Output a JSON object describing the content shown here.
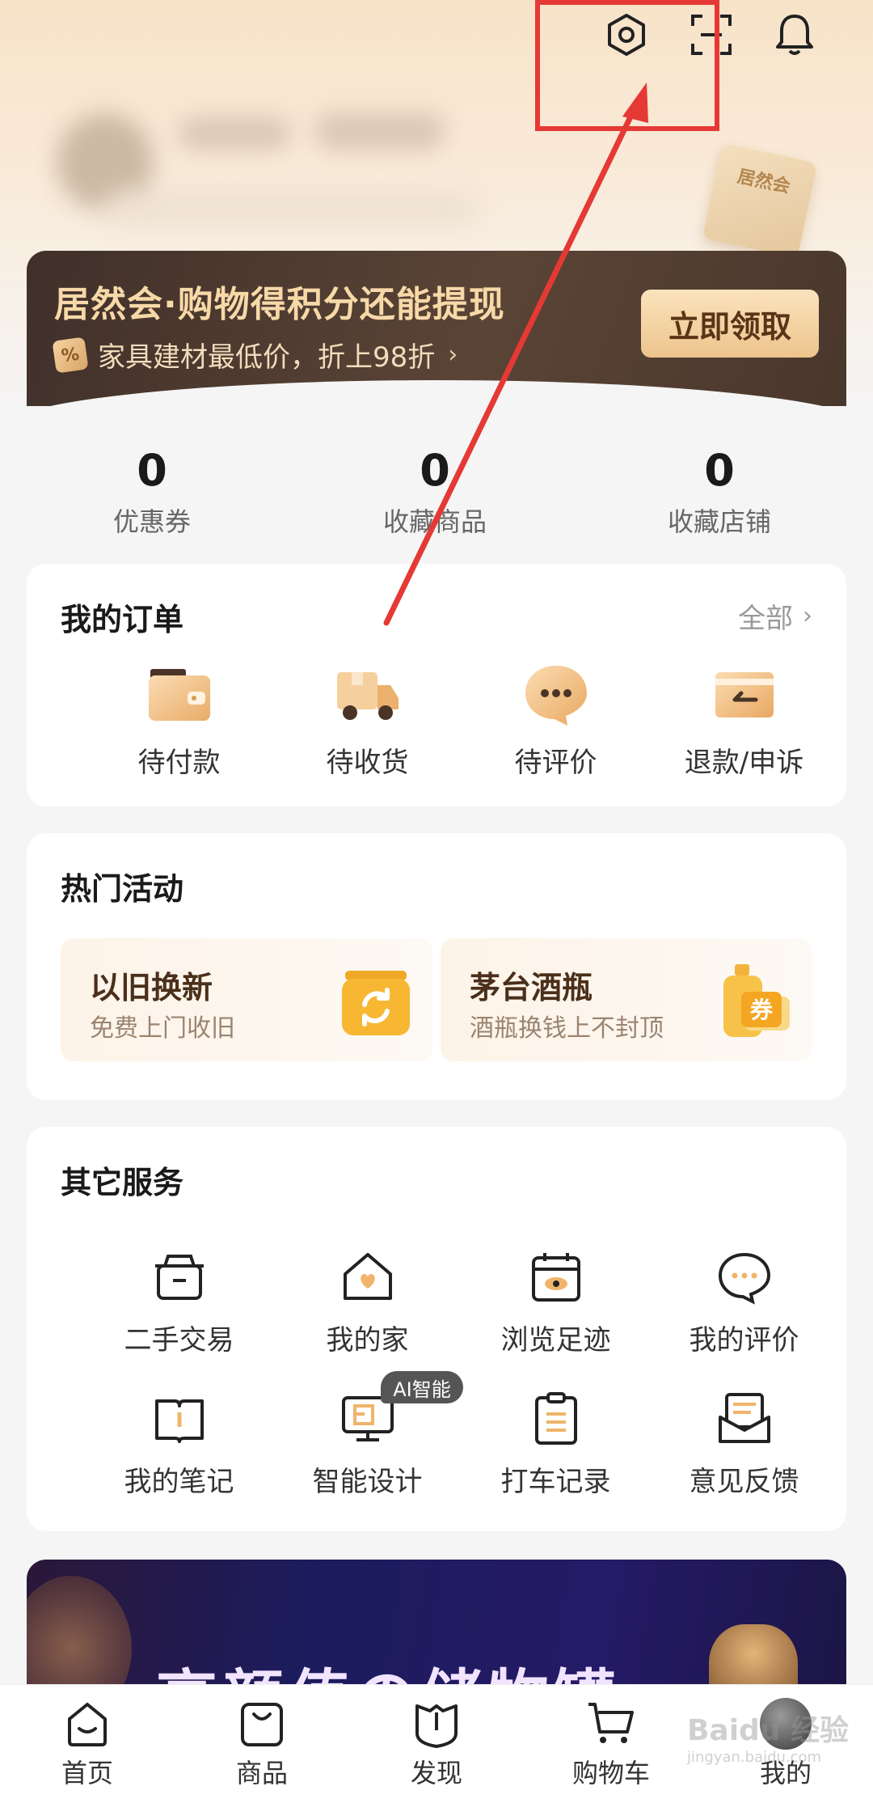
{
  "header": {
    "icons": [
      "settings-icon",
      "scan-icon",
      "bell-icon"
    ],
    "card_label": "居然会"
  },
  "banner": {
    "title": "居然会·购物得积分还能提现",
    "subtitle": "家具建材最低价，折上98折",
    "badge": "%",
    "button": "立即领取"
  },
  "stats": [
    {
      "value": "0",
      "label": "优惠券"
    },
    {
      "value": "0",
      "label": "收藏商品"
    },
    {
      "value": "0",
      "label": "收藏店铺"
    }
  ],
  "orders": {
    "title": "我的订单",
    "all_label": "全部",
    "items": [
      {
        "label": "待付款",
        "icon": "wallet-icon"
      },
      {
        "label": "待收货",
        "icon": "truck-icon"
      },
      {
        "label": "待评价",
        "icon": "chat-bubble-icon"
      },
      {
        "label": "退款/申诉",
        "icon": "refund-card-icon"
      }
    ]
  },
  "activities": {
    "title": "热门活动",
    "items": [
      {
        "title": "以旧换新",
        "subtitle": "免费上门收旧",
        "icon": "recycle-icon"
      },
      {
        "title": "茅台酒瓶",
        "subtitle": "酒瓶换钱上不封顶",
        "icon": "coupon-bottle-icon",
        "icon_text": "券"
      }
    ]
  },
  "services": {
    "title": "其它服务",
    "items": [
      {
        "label": "二手交易",
        "icon": "box-icon"
      },
      {
        "label": "我的家",
        "icon": "home-heart-icon"
      },
      {
        "label": "浏览足迹",
        "icon": "calendar-eye-icon"
      },
      {
        "label": "我的评价",
        "icon": "comment-icon"
      },
      {
        "label": "我的笔记",
        "icon": "notebook-icon"
      },
      {
        "label": "智能设计",
        "icon": "monitor-icon",
        "badge": "AI智能"
      },
      {
        "label": "打车记录",
        "icon": "clipboard-icon"
      },
      {
        "label": "意见反馈",
        "icon": "feedback-envelope-icon"
      }
    ]
  },
  "promo": {
    "text": "高颜值の储物罐"
  },
  "tabbar": [
    {
      "label": "首页",
      "icon": "home-smile-icon"
    },
    {
      "label": "商品",
      "icon": "shopping-bag-icon"
    },
    {
      "label": "发现",
      "icon": "discover-shield-icon"
    },
    {
      "label": "购物车",
      "icon": "cart-icon"
    },
    {
      "label": "我的",
      "icon": "avatar"
    }
  ],
  "watermark": {
    "text": "Baidu 经验",
    "sub": "jingyan.baidu.com"
  },
  "colors": {
    "annotation": "#e53935",
    "banner_bg": "#4a372c",
    "banner_gold": "#f7d9a8",
    "accent_orange": "#f5a623"
  }
}
